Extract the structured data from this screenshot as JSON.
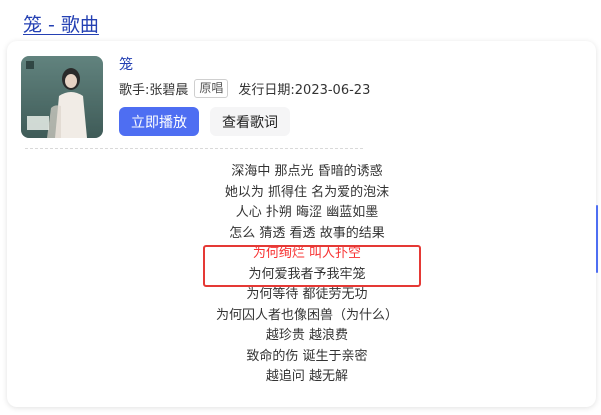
{
  "header": {
    "title": "笼 - 歌曲"
  },
  "song": {
    "name": "笼",
    "artist_label": "歌手:张碧晨",
    "badge": "原唱",
    "release_label": "发行日期:2023-06-23"
  },
  "buttons": {
    "play": "立即播放",
    "lyrics": "查看歌词"
  },
  "lyrics": [
    "深海中 那点光 昏暗的诱惑",
    "她以为 抓得住 名为爱的泡沫",
    "人心 扑朔 晦涩 幽蓝如墨",
    "怎么 猜透 看透 故事的结果",
    "为何绚烂 叫人扑空",
    "为何爱我者予我牢笼",
    "为何等待 都徒劳无功",
    "为何囚人者也像困兽（为什么）",
    "越珍贵 越浪费",
    "致命的伤 诞生于亲密",
    "越追问 越无解"
  ],
  "colors": {
    "link": "#2440b3",
    "primary": "#4e6ef2",
    "highlight": "#f73131",
    "box": "#e53935"
  }
}
